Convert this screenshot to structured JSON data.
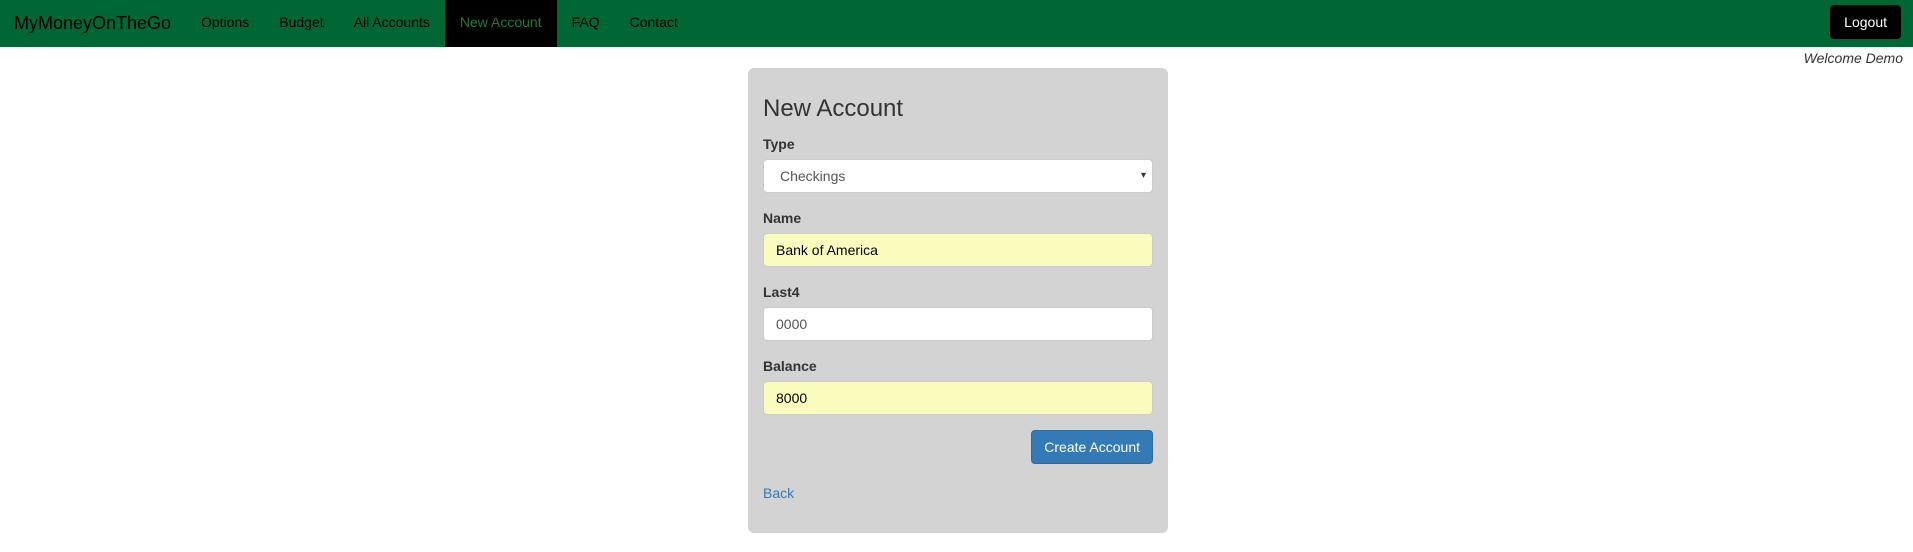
{
  "navbar": {
    "brand": "MyMoneyOnTheGo",
    "items": [
      {
        "label": "Options"
      },
      {
        "label": "Budget"
      },
      {
        "label": "All Accounts"
      },
      {
        "label": "New Account",
        "active": true
      },
      {
        "label": "FAQ"
      },
      {
        "label": "Contact"
      }
    ],
    "logout_label": "Logout",
    "bg_color": "#006633"
  },
  "welcome": "Welcome Demo",
  "form": {
    "title": "New Account",
    "type": {
      "label": "Type",
      "value": "Checkings"
    },
    "name": {
      "label": "Name",
      "value": "Bank of America"
    },
    "last4": {
      "label": "Last4",
      "value": "0000"
    },
    "balance": {
      "label": "Balance",
      "value": "8000"
    },
    "submit_label": "Create Account",
    "back_label": "Back"
  }
}
